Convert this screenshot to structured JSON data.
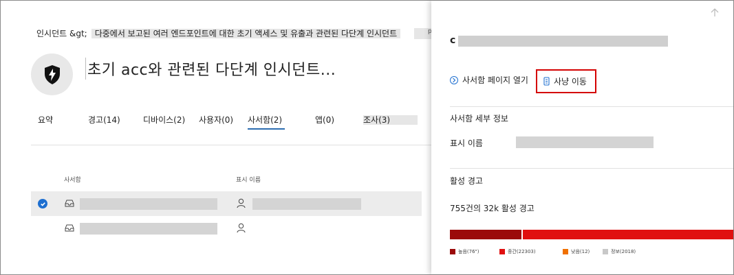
{
  "breadcrumb": {
    "root": "인시던트 &gt;",
    "current": "다중에서 보고된 여러 엔드포인트에 대한 초기 액세스 및 유출과 관련된 다단계 인시던트",
    "suffix": "p"
  },
  "incident": {
    "title": "초기 acc와 관련된 다단계 인시던트..."
  },
  "tabs": [
    {
      "label": "요약"
    },
    {
      "label": "경고(14)"
    },
    {
      "label": "디바이스(2)"
    },
    {
      "label": "사용자(0)"
    },
    {
      "label": "사서함(2)"
    },
    {
      "label": "앱(0)"
    },
    {
      "label": "조사(3)"
    }
  ],
  "table": {
    "columns": [
      "사서함",
      "표시 이름"
    ]
  },
  "panel": {
    "title_prefix": "c",
    "open_mailbox_link": "사서함 페이지 열기",
    "move_action": "사냥 이동",
    "mailbox_details_header": "사서함 세부 정보",
    "display_name_label": "표시 이름",
    "active_alerts_header": "활성 경고",
    "active_alerts_count": "755건의 32k 활성 경고",
    "severity": [
      {
        "label": "높음(76\")",
        "value": 76,
        "color": "#9b0a0a"
      },
      {
        "label": "중간(22303)",
        "value": 22303,
        "color": "#e01010"
      },
      {
        "label": "낮음(12)",
        "value": 12,
        "color": "#f07000"
      },
      {
        "label": "정보(2018)",
        "value": 2018,
        "color": "#c8c8c8"
      }
    ]
  },
  "colors": {
    "accent": "#1e6fd0",
    "highlight_box": "#d40000"
  }
}
